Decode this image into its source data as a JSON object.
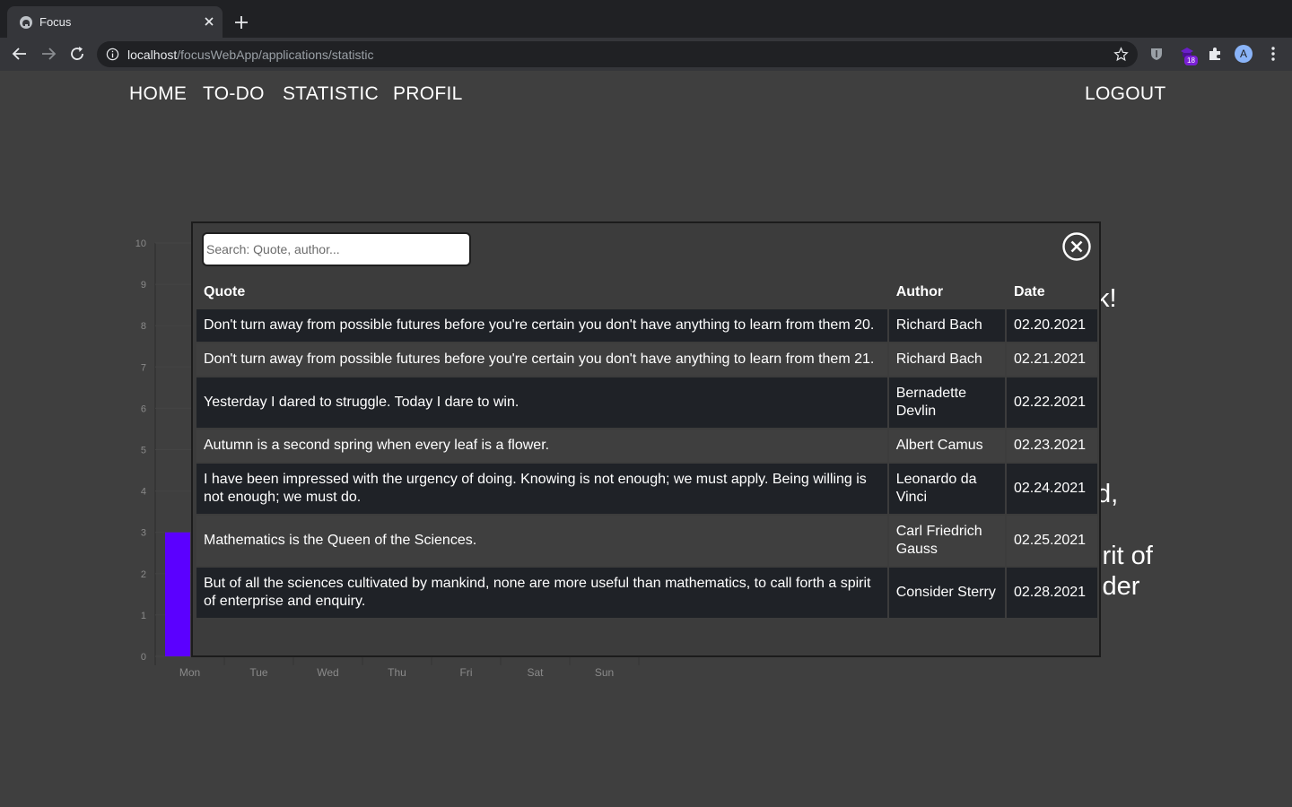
{
  "browser": {
    "tab_title": "Focus",
    "url_host": "localhost",
    "url_path": "/focusWebApp/applications/statistic",
    "extension_badge": "18",
    "profile_initial": "A"
  },
  "nav": {
    "home": "HOME",
    "todo": "TO-DO",
    "statistic": "STATISTIC",
    "profil": "PROFIL",
    "logout": "LOGOUT"
  },
  "background_text": {
    "fragment_1": "k!",
    "fragment_2": "d,",
    "fragment_3": "irit of",
    "fragment_4": "ider"
  },
  "modal": {
    "search_placeholder": "Search: Quote, author...",
    "columns": {
      "quote": "Quote",
      "author": "Author",
      "date": "Date"
    },
    "rows": [
      {
        "quote": "Don't turn away from possible futures before you're certain you don't have anything to learn from them 20.",
        "author": "Richard Bach",
        "date": "02.20.2021"
      },
      {
        "quote": "Don't turn away from possible futures before you're certain you don't have anything to learn from them 21.",
        "author": "Richard Bach",
        "date": "02.21.2021"
      },
      {
        "quote": "Yesterday I dared to struggle. Today I dare to win.",
        "author": "Bernadette Devlin",
        "date": "02.22.2021"
      },
      {
        "quote": "Autumn is a second spring when every leaf is a flower.",
        "author": "Albert Camus",
        "date": "02.23.2021"
      },
      {
        "quote": "I have been impressed with the urgency of doing. Knowing is not enough; we must apply. Being willing is not enough; we must do.",
        "author": "Leonardo da Vinci",
        "date": "02.24.2021"
      },
      {
        "quote": "Mathematics is the Queen of the Sciences.",
        "author": "Carl Friedrich Gauss",
        "date": "02.25.2021"
      },
      {
        "quote": "But of all the sciences cultivated by mankind, none are more useful than mathematics, to call forth a spirit of enterprise and enquiry.",
        "author": "Consider Sterry",
        "date": "02.28.2021"
      }
    ]
  },
  "chart_data": {
    "type": "bar",
    "categories": [
      "Mon",
      "Tue",
      "Wed",
      "Thu",
      "Fri",
      "Sat",
      "Sun"
    ],
    "values": [
      3,
      0,
      0,
      0,
      0,
      0,
      0
    ],
    "y_ticks": [
      "0",
      "1",
      "2",
      "3",
      "4",
      "5",
      "6",
      "7",
      "8",
      "9",
      "10"
    ],
    "ylim": [
      0,
      10
    ],
    "bar_color": "#5b00ff",
    "grid": true
  },
  "colors": {
    "page_bg": "#3f3f3f",
    "row_dark": "#1f2227",
    "row_light": "#3f3f3f",
    "accent": "#5b00ff"
  }
}
